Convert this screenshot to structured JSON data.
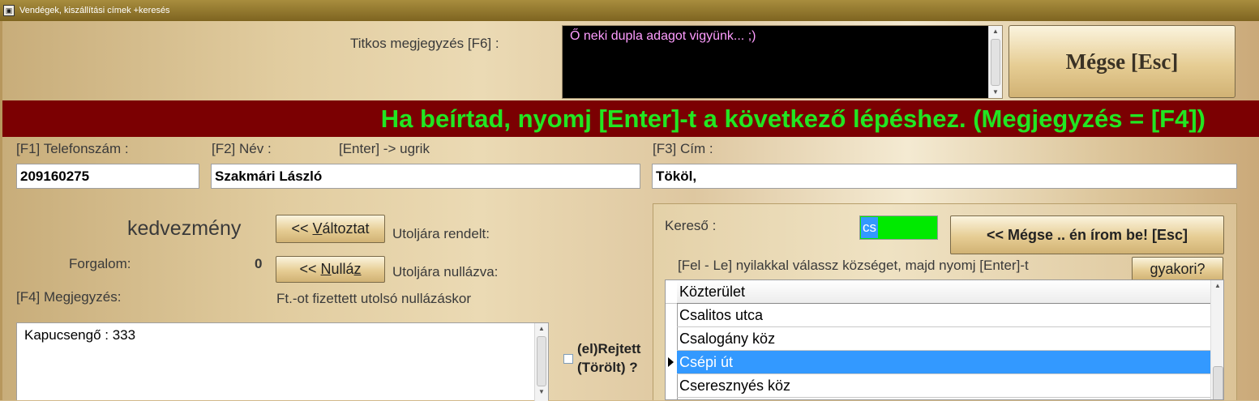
{
  "window": {
    "title": "Vendégek, kiszállítási címek +keresés"
  },
  "secret_note": {
    "label": "Titkos megjegyzés [F6]  :",
    "value": "Ő neki dupla adagot vigyünk... ;)"
  },
  "cancel_button": {
    "label": "Mégse [Esc]"
  },
  "banner": {
    "text": "Ha beírtad, nyomj [Enter]-t a következő lépéshez. (Megjegyzés = [F4])"
  },
  "fields": {
    "phone_label": "[F1] Telefonszám :",
    "phone_value": "209160275",
    "name_label": "[F2] Név :",
    "name_hint": "[Enter] -> ugrik",
    "name_value": "Szakmári László",
    "address_label": "[F3] Cím :",
    "address_value": "Tököl,"
  },
  "discount": {
    "label": "kedvezmény",
    "change_button_prefix": "<< ",
    "change_button_underlined": "V",
    "change_button_rest": "áltoztat",
    "last_ordered_label": "Utoljára rendelt:",
    "turnover_label": "Forgalom:",
    "turnover_value": "0",
    "reset_button_prefix": "<< ",
    "reset_button_underlined": "N",
    "reset_button_rest": "ullá",
    "reset_button_suffix_underlined": "z",
    "last_reset_label": "Utoljára nullázva:",
    "paid_label": "Ft.-ot fizettett utolsó nullázáskor"
  },
  "note": {
    "label": "[F4] Megjegyzés:",
    "value": "Kapucsengő : 333"
  },
  "hidden": {
    "line1": "(el)Rejtett",
    "line2": "(Törölt) ?"
  },
  "search": {
    "label": "Kereső :",
    "value": "cs",
    "cancel_button": "<< Mégse .. én írom be! [Esc]",
    "instruction": "[Fel - Le] nyilakkal válassz községet, majd nyomj [Enter]-t",
    "frequent_button": "gyakori?",
    "column_header": "Közterület",
    "rows": [
      "Csalitos utca",
      "Csalogány köz",
      "Csépi út",
      "Cseresznyés köz"
    ],
    "selected_index": 2
  }
}
